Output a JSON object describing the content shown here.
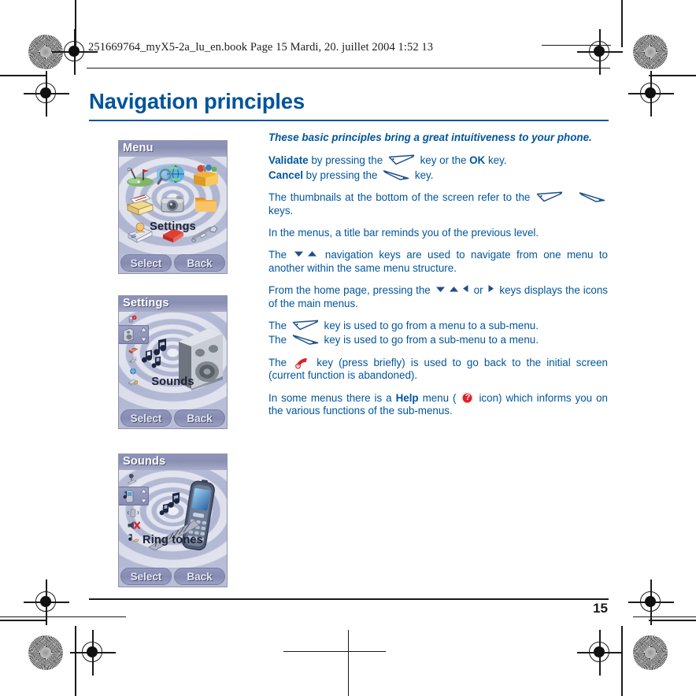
{
  "document": {
    "slug_line": "251669764_myX5-2a_lu_en.book  Page 15  Mardi, 20. juillet 2004  1:52 13",
    "chapter_title": "Navigation principles",
    "page_number": "15",
    "accent_color": "#00539b",
    "body_color": "#00559c",
    "help_icon_color": "#d8232a"
  },
  "body": {
    "lede": "These basic principles bring a great intuitiveness to your phone.",
    "validate_label": "Validate",
    "validate_text_1": " by pressing the ",
    "validate_text_2": " key or the ",
    "ok_label": "OK",
    "validate_text_3": " key.",
    "cancel_label": "Cancel",
    "cancel_text_1": " by pressing the ",
    "cancel_text_2": " key.",
    "thumbnails_text_1": "The thumbnails at the bottom of the screen refer to the ",
    "thumbnails_text_2": " keys.",
    "titlebar_text": "In the menus, a title bar reminds you of the previous level.",
    "nav_text_1": "The ",
    "nav_text_2": " navigation keys are used to navigate from one menu to another within the same menu structure.",
    "home_text_1": "From the home page, pressing the ",
    "home_text_2": " or ",
    "home_text_3": " keys displays the icons of the main menus.",
    "menu_to_sub_1": "The ",
    "menu_to_sub_2": " key  is used to go from a menu to a sub-menu.",
    "sub_to_menu_1": "The ",
    "sub_to_menu_2": " key is used to go from a sub-menu to a menu.",
    "endcall_1": "The ",
    "endcall_2": " key (press briefly) is used to go back to the initial screen (current function is abandoned).",
    "help_1": "In some menus there is a ",
    "help_label": "Help",
    "help_2": " menu ( ",
    "help_3": " icon) which informs you on the various functions of the sub-menus."
  },
  "screens": [
    {
      "id": "menu",
      "title": "Menu",
      "label": "Settings",
      "softkey_left": "Select",
      "softkey_right": "Back",
      "icons": [
        "golf-game-icon",
        "globe-search-icon",
        "toolbox-services-icon",
        "messages-icon",
        "camera-icon",
        "folder-icon",
        "contacts-icon",
        "organiser-book-icon",
        "settings-tools-icon"
      ]
    },
    {
      "id": "settings",
      "title": "Settings",
      "label": "Sounds",
      "softkey_left": "Select",
      "softkey_right": "Back",
      "rail_icons": [
        "help-icon",
        "sounds-speaker-icon",
        "display-icon",
        "keys-icon",
        "network-icon",
        "security-icon"
      ],
      "hero_icon": "loudspeaker-icon"
    },
    {
      "id": "sounds",
      "title": "Sounds",
      "label": "Ring tones",
      "softkey_left": "Select",
      "softkey_right": "Back",
      "rail_icons": [
        "alert-icon",
        "ring-tones-icon",
        "vibrate-icon",
        "silent-mute-icon",
        "beep-icon"
      ],
      "hero_icon": "phone-ringing-icon"
    }
  ],
  "glyphs": {
    "validate_key": "left-soft-key-glyph",
    "cancel_key": "right-soft-key-glyph",
    "down_arrow": "▼",
    "up_arrow": "▲",
    "left_arrow": "◀",
    "right_arrow": "▶",
    "end_call_key": "end-call-key-glyph",
    "help_badge": "?"
  }
}
